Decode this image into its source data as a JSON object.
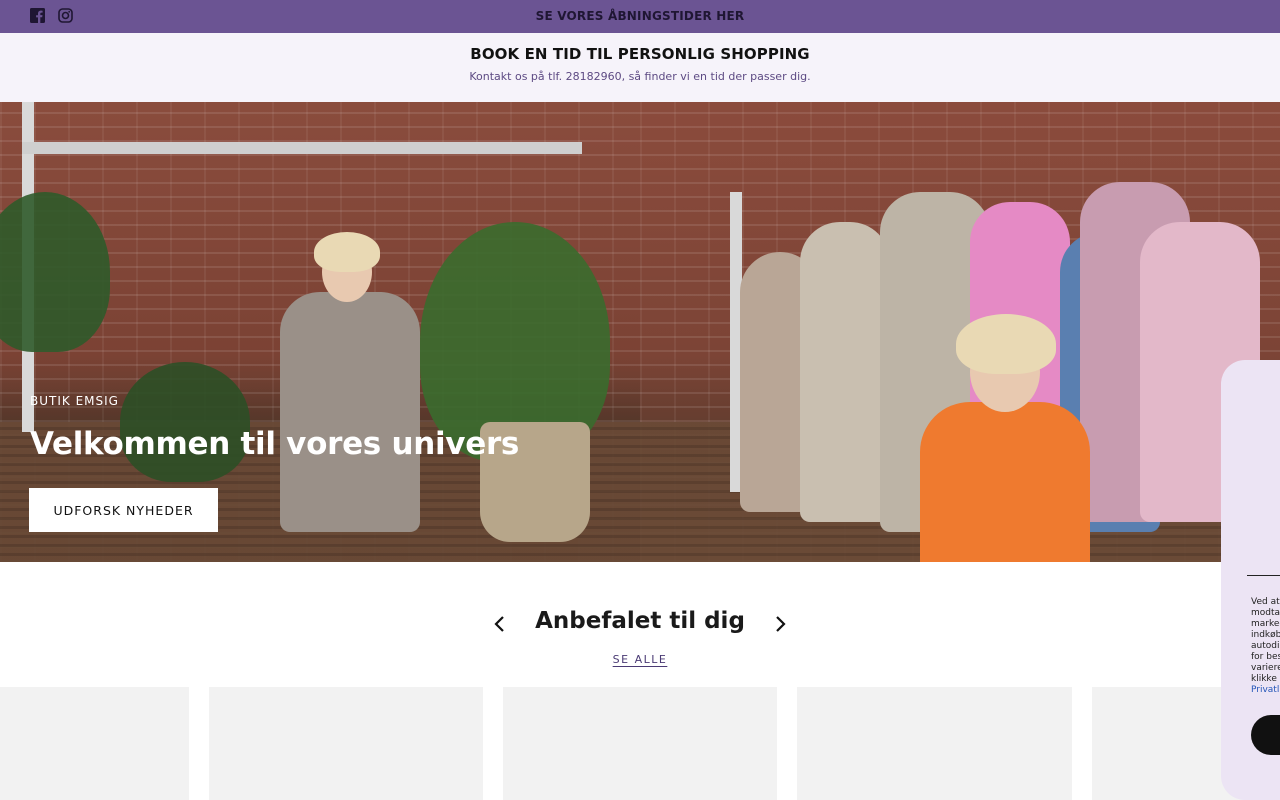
{
  "topbar": {
    "announcement": "SE VORES ÅBNINGSTIDER HER",
    "social": [
      "facebook-icon",
      "instagram-icon"
    ]
  },
  "booking": {
    "title": "BOOK EN TID TIL PERSONLIG SHOPPING",
    "subtitle": "Kontakt os på tlf. 28182960, så finder vi en tid der passer dig."
  },
  "hero": {
    "eyebrow": "BUTIK EMSIG",
    "heading": "Velkommen til vores univers",
    "cta_label": "UDFORSK NYHEDER"
  },
  "recommendations": {
    "title": "Anbefalet til dig",
    "see_all_label": "SE ALLE"
  },
  "consent": {
    "lines": [
      "Ved at",
      "modtag",
      "marked",
      "indkøb",
      "autodi",
      "for bes",
      "variere",
      "klikke p"
    ],
    "privacy_link": "Privatli"
  },
  "colors": {
    "topbar": "#6b5493",
    "booking_bg": "#f6f3fa",
    "consent_bg": "#ece4f4",
    "accent_text": "#4a3a74"
  }
}
